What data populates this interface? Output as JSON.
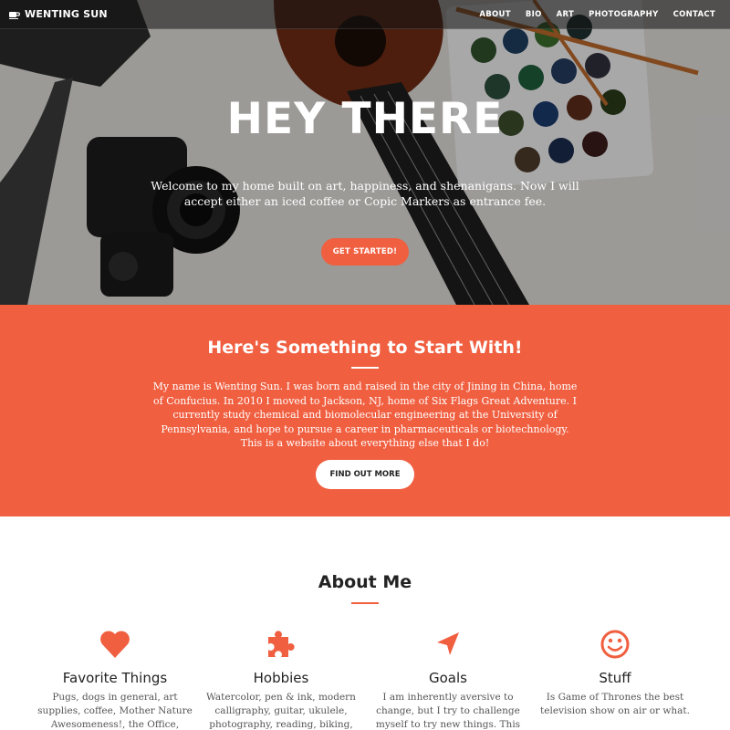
{
  "brand": {
    "name": "WENTING SUN",
    "icon": "coffee-cup-icon"
  },
  "nav": [
    {
      "label": "ABOUT"
    },
    {
      "label": "BIO"
    },
    {
      "label": "ART"
    },
    {
      "label": "PHOTOGRAPHY"
    },
    {
      "label": "CONTACT"
    }
  ],
  "hero": {
    "title": "HEY THERE",
    "text": "Welcome to my home built on art, happiness, and shenanigans. Now I will accept either an iced coffee or Copic Markers as entrance fee.",
    "button": "GET STARTED!"
  },
  "intro": {
    "title": "Here's Something to Start With!",
    "text": "My name is Wenting Sun. I was born and raised in the city of Jining in China, home of Confucius. In 2010 I moved to Jackson, NJ, home of Six Flags Great Adventure. I currently study chemical and biomolecular engineering at the University of Pennsylvania, and hope to pursue a career in pharmaceuticals or biotechnology. This is a website about everything else that I do!",
    "button": "FIND OUT MORE"
  },
  "about": {
    "title": "About Me",
    "features": [
      {
        "icon": "heart-icon",
        "title": "Favorite Things",
        "text": "Pugs, dogs in general, art supplies, coffee, Mother Nature Awesomeness!, the Office,"
      },
      {
        "icon": "puzzle-icon",
        "title": "Hobbies",
        "text": "Watercolor, pen & ink, modern calligraphy, guitar, ukulele, photography, reading, biking,"
      },
      {
        "icon": "location-arrow-icon",
        "title": "Goals",
        "text": "I am inherently aversive to change, but I try to challenge myself to try new things. This"
      },
      {
        "icon": "smile-icon",
        "title": "Stuff",
        "text": "Is Game of Thrones the best television show on air or what."
      }
    ]
  },
  "colors": {
    "accent": "#f05f40",
    "heading": "#222222",
    "muted": "#555555"
  }
}
